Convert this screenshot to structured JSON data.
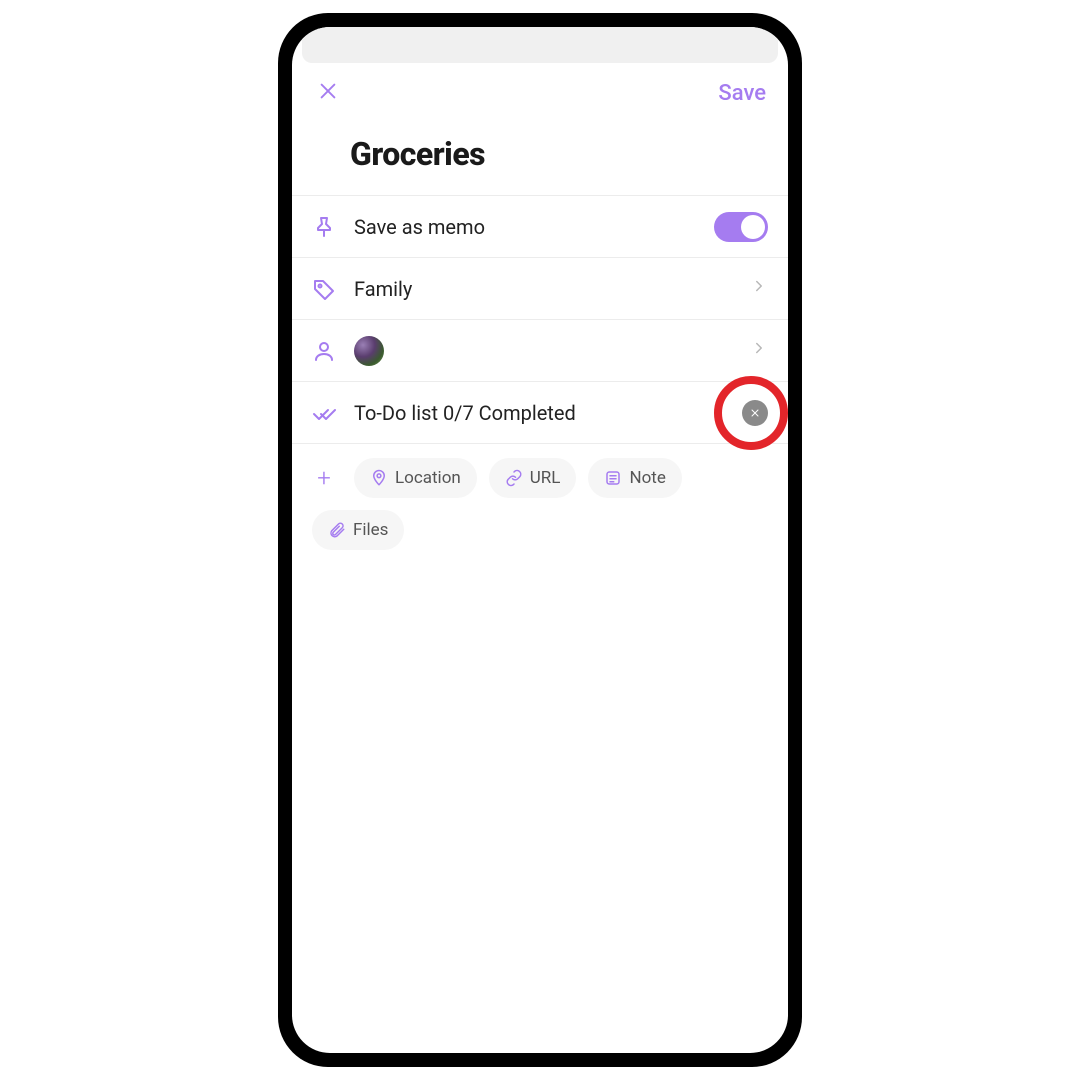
{
  "header": {
    "save_label": "Save"
  },
  "title": "Groceries",
  "rows": {
    "memo": {
      "label": "Save as memo",
      "toggle_on": true
    },
    "tag": {
      "label": "Family"
    },
    "todo": {
      "label": "To-Do list 0/7 Completed"
    }
  },
  "chips": {
    "location": "Location",
    "url": "URL",
    "note": "Note",
    "files": "Files"
  }
}
